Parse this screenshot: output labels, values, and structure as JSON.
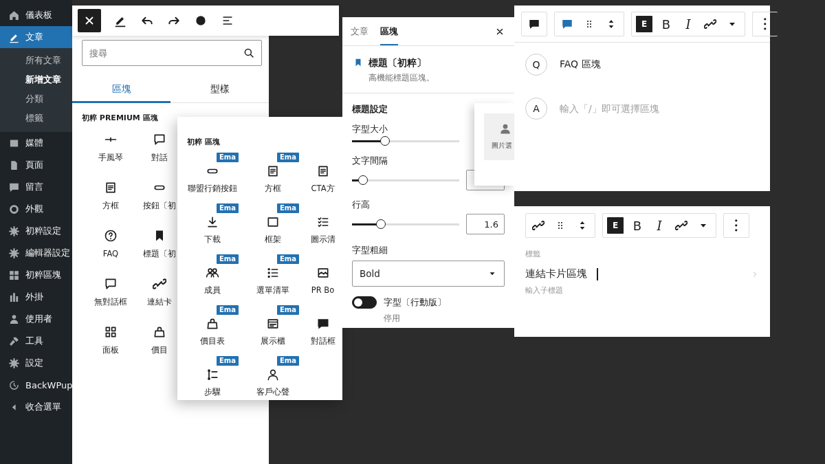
{
  "sidebar": {
    "items": [
      {
        "label": "儀表板",
        "selected": false
      },
      {
        "label": "文章",
        "selected": true,
        "children": [
          {
            "label": "所有文章",
            "selected": false
          },
          {
            "label": "新增文章",
            "selected": true
          },
          {
            "label": "分類",
            "selected": false
          },
          {
            "label": "標籤",
            "selected": false
          }
        ]
      },
      {
        "label": "媒體",
        "selected": false
      },
      {
        "label": "頁面",
        "selected": false
      },
      {
        "label": "留言",
        "selected": false
      },
      {
        "label": "外觀",
        "selected": false
      },
      {
        "label": "初粹設定",
        "selected": false
      },
      {
        "label": "編輯器設定",
        "selected": false
      },
      {
        "label": "初粹區塊",
        "selected": false
      },
      {
        "label": "外掛",
        "selected": false
      },
      {
        "label": "使用者",
        "selected": false
      },
      {
        "label": "工具",
        "selected": false
      },
      {
        "label": "設定",
        "selected": false
      },
      {
        "label": "BackWPup",
        "selected": false
      },
      {
        "label": "收合選單",
        "selected": false
      }
    ]
  },
  "inserter": {
    "search": {
      "placeholder": "搜尋"
    },
    "tabs": [
      {
        "label": "區塊",
        "selected": true
      },
      {
        "label": "型樣",
        "selected": false
      }
    ],
    "section_title": "初粹 PREMIUM 區塊",
    "blocks": [
      {
        "label": "手風琴"
      },
      {
        "label": "對話"
      },
      {
        "label": "方框"
      },
      {
        "label": "按鈕〔初"
      },
      {
        "label": "FAQ"
      },
      {
        "label": "標題〔初"
      },
      {
        "label": "無對話框"
      },
      {
        "label": "連結卡"
      },
      {
        "label": "面板"
      },
      {
        "label": "價目"
      }
    ]
  },
  "block_popup": {
    "section_title": "初粹 區塊",
    "blocks": [
      {
        "label": "聯盟行銷按鈕",
        "badge": "Ema"
      },
      {
        "label": "方框",
        "badge": "Ema"
      },
      {
        "label": "CTA方"
      },
      {
        "label": "下載",
        "badge": "Ema"
      },
      {
        "label": "框架",
        "badge": "Ema"
      },
      {
        "label": "圖示清"
      },
      {
        "label": "成員",
        "badge": "Ema"
      },
      {
        "label": "選單清單",
        "badge": "Ema"
      },
      {
        "label": "PR Bo"
      },
      {
        "label": "價目表",
        "badge": "Ema"
      },
      {
        "label": "展示櫃",
        "badge": "Ema"
      },
      {
        "label": "對話框"
      },
      {
        "label": "步驟",
        "badge": "Ema"
      },
      {
        "label": "客戶心聲",
        "badge": "Ema"
      }
    ]
  },
  "settings_panel": {
    "tabs": [
      {
        "label": "文章",
        "selected": false
      },
      {
        "label": "區塊",
        "selected": true
      }
    ],
    "block": {
      "title": "標題〔初粹〕",
      "description": "高機能標題區塊。"
    },
    "section_title": "標題設定",
    "controls": [
      {
        "kind": "slider",
        "label": "字型大小",
        "level": 0.31
      },
      {
        "kind": "slider_field",
        "label": "文字間隔",
        "level": 0.1
      },
      {
        "kind": "slider_field",
        "label": "行高",
        "level": 0.27,
        "value": "1.6"
      },
      {
        "kind": "select",
        "label": "字型粗細",
        "value": "Bold"
      },
      {
        "kind": "toggle",
        "label": "字型〔行動版〕",
        "on": false,
        "status": "停用"
      }
    ]
  },
  "image_picker": {
    "label": "圖片選"
  },
  "faq_block": {
    "format_buttons": [
      {
        "kind": "style",
        "label": "E"
      },
      {
        "kind": "bold",
        "label": "B"
      },
      {
        "kind": "italic",
        "label": "I"
      }
    ],
    "rows": [
      {
        "marker": "Q",
        "text": "FAQ 區塊"
      },
      {
        "marker": "A",
        "placeholder": "輸入「/」即可選擇區塊"
      }
    ]
  },
  "link_card_block": {
    "format_buttons": [
      {
        "kind": "style",
        "label": "E"
      },
      {
        "kind": "bold",
        "label": "B"
      },
      {
        "kind": "italic",
        "label": "I"
      }
    ],
    "label": "標籤",
    "title": "連結卡片區塊",
    "subtitle": {
      "placeholder": "輸入子標題"
    }
  }
}
